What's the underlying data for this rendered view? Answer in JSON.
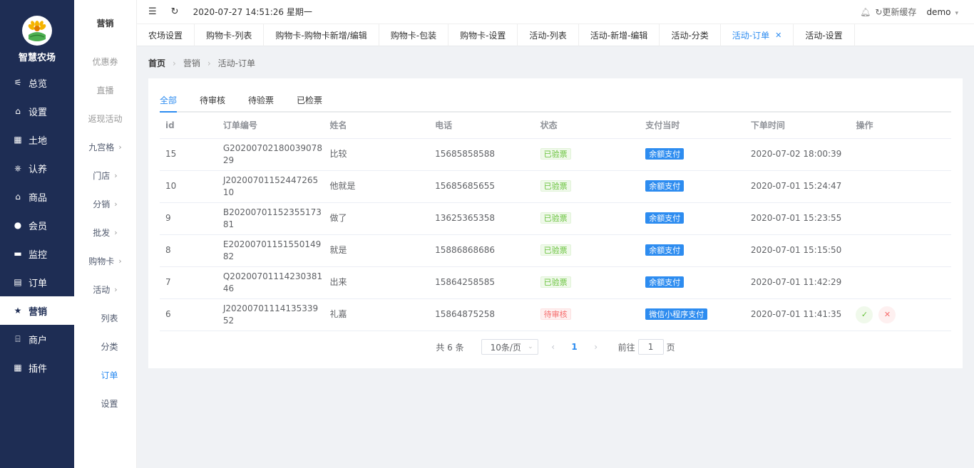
{
  "app": {
    "name": "智慧农场"
  },
  "nav": [
    {
      "label": "总览",
      "icon": "sliders-icon"
    },
    {
      "label": "设置",
      "icon": "bag-icon"
    },
    {
      "label": "土地",
      "icon": "grid-icon"
    },
    {
      "label": "认养",
      "icon": "network-icon"
    },
    {
      "label": "商品",
      "icon": "bag-icon"
    },
    {
      "label": "会员",
      "icon": "user-icon"
    },
    {
      "label": "监控",
      "icon": "camera-icon"
    },
    {
      "label": "订单",
      "icon": "clipboard-icon"
    },
    {
      "label": "营销",
      "icon": "star-icon",
      "active": true
    },
    {
      "label": "商户",
      "icon": "store-icon"
    },
    {
      "label": "插件",
      "icon": "grid-icon"
    }
  ],
  "subnav": {
    "title": "营销",
    "items": [
      {
        "label": "优惠券",
        "muted": true
      },
      {
        "label": "直播",
        "muted": true
      },
      {
        "label": "返现活动",
        "muted": true
      },
      {
        "label": "九宫格",
        "arrow": true
      },
      {
        "label": "门店",
        "arrow": true
      },
      {
        "label": "分销",
        "arrow": true
      },
      {
        "label": "批发",
        "arrow": true
      },
      {
        "label": "购物卡",
        "arrow": true
      },
      {
        "label": "活动",
        "arrow": true
      },
      {
        "label": "列表",
        "child": true
      },
      {
        "label": "分类",
        "child": true
      },
      {
        "label": "订单",
        "child": true,
        "active": true
      },
      {
        "label": "设置",
        "child": true
      }
    ]
  },
  "topbar": {
    "datetime": "2020-07-27 14:51:26 星期一",
    "refresh_cache": "更新缓存",
    "user": "demo"
  },
  "tabs": [
    {
      "label": "农场设置"
    },
    {
      "label": "购物卡-列表"
    },
    {
      "label": "购物卡-购物卡新增/编辑"
    },
    {
      "label": "购物卡-包装"
    },
    {
      "label": "购物卡-设置"
    },
    {
      "label": "活动-列表"
    },
    {
      "label": "活动-新增-编辑"
    },
    {
      "label": "活动-分类"
    },
    {
      "label": "活动-订单",
      "active": true
    },
    {
      "label": "活动-设置"
    }
  ],
  "breadcrumb": {
    "home": "首页",
    "level1": "营销",
    "level2": "活动-订单"
  },
  "status_tabs": [
    "全部",
    "待审核",
    "待验票",
    "已检票"
  ],
  "table": {
    "headers": [
      "id",
      "订单编号",
      "姓名",
      "电话",
      "状态",
      "支付当时",
      "下单时间",
      "操作"
    ],
    "rows": [
      {
        "id": "15",
        "order_no": "G2020070218003907829",
        "name": "比较",
        "phone": "15685858588",
        "status": "已验票",
        "status_color": "green",
        "pay": "余额支付",
        "time": "2020-07-02 18:00:39",
        "actions": false
      },
      {
        "id": "10",
        "order_no": "J2020070115244726510",
        "name": "他就是",
        "phone": "15685685655",
        "status": "已验票",
        "status_color": "green",
        "pay": "余额支付",
        "time": "2020-07-01 15:24:47",
        "actions": false
      },
      {
        "id": "9",
        "order_no": "B2020070115235517381",
        "name": "做了",
        "phone": "13625365358",
        "status": "已验票",
        "status_color": "green",
        "pay": "余额支付",
        "time": "2020-07-01 15:23:55",
        "actions": false
      },
      {
        "id": "8",
        "order_no": "E2020070115155014982",
        "name": "就是",
        "phone": "15886868686",
        "status": "已验票",
        "status_color": "green",
        "pay": "余额支付",
        "time": "2020-07-01 15:15:50",
        "actions": false
      },
      {
        "id": "7",
        "order_no": "Q2020070111423038146",
        "name": "出来",
        "phone": "15864258585",
        "status": "已验票",
        "status_color": "green",
        "pay": "余额支付",
        "time": "2020-07-01 11:42:29",
        "actions": false
      },
      {
        "id": "6",
        "order_no": "J2020070111413533952",
        "name": "礼嘉",
        "phone": "15864875258",
        "status": "待审核",
        "status_color": "red",
        "pay": "微信小程序支付",
        "time": "2020-07-01 11:41:35",
        "actions": true
      }
    ]
  },
  "pagination": {
    "total": "共 6 条",
    "page_size": "10条/页",
    "current": "1",
    "goto_label": "前往",
    "goto_value": "1",
    "page_suffix": "页"
  },
  "colors": {
    "sidebar": "#1e2d54",
    "accent": "#2d8cf0"
  }
}
